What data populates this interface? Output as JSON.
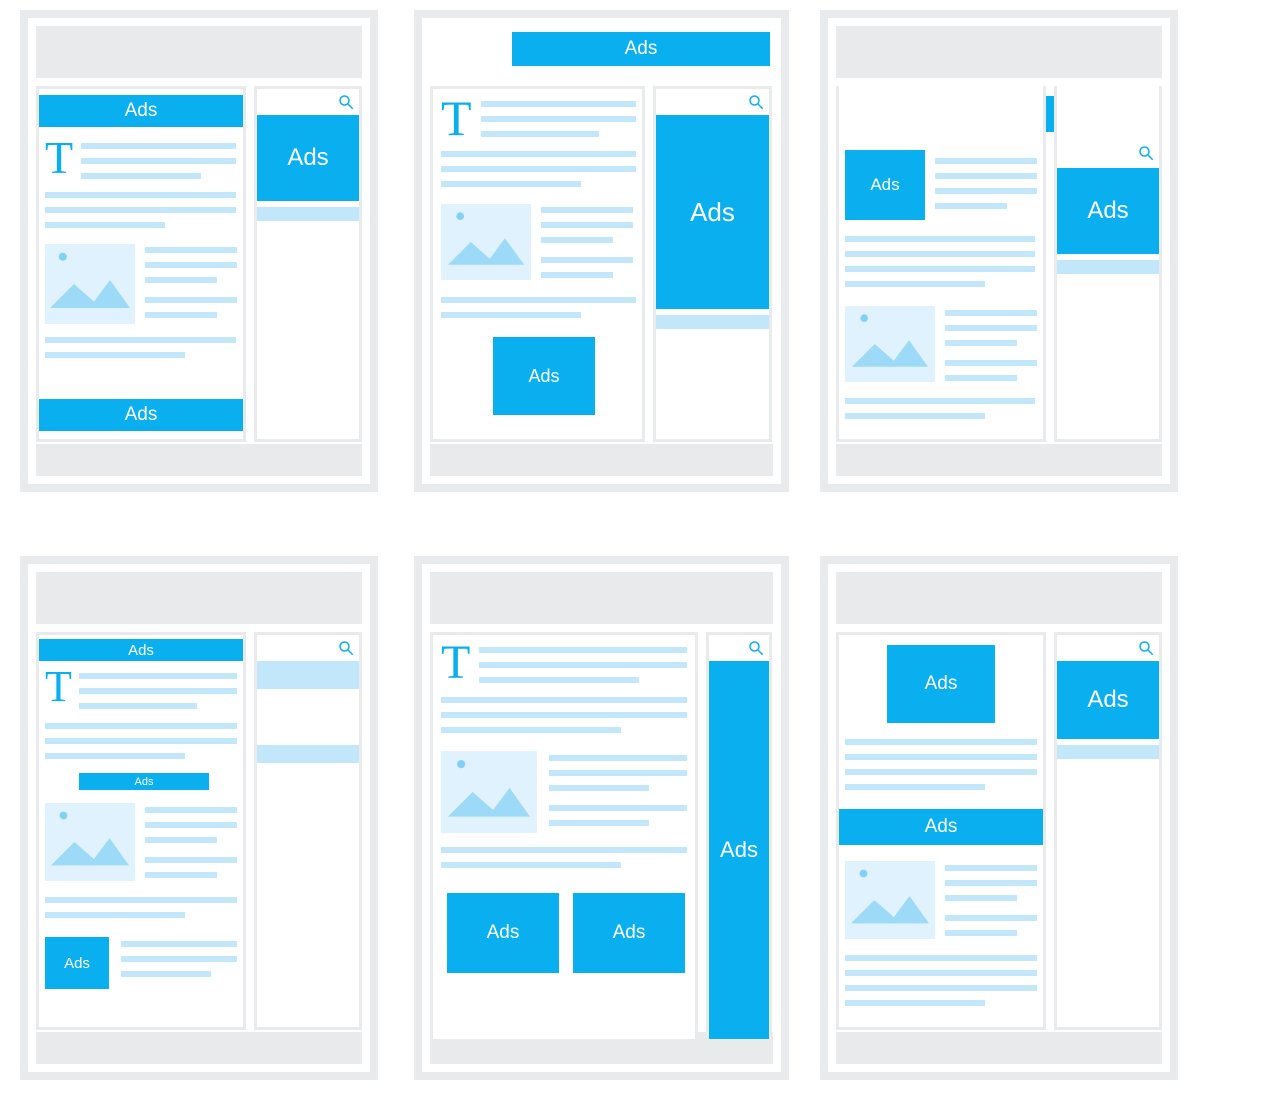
{
  "ads_label": "Ads",
  "dropcap": "T",
  "colors": {
    "accent": "#09afef",
    "pale": "#c2e7fb",
    "paler": "#dff2fd",
    "frame": "#e9eaec"
  },
  "panels": [
    {
      "id": 1,
      "ads": [
        "top-banner",
        "sidebar-rect",
        "bottom-banner"
      ],
      "dropcap": true,
      "search": true
    },
    {
      "id": 2,
      "ads": [
        "hero-banner",
        "tall-sidebar",
        "inline-rect"
      ],
      "dropcap": true,
      "search": true
    },
    {
      "id": 3,
      "ads": [
        "wide-banner",
        "square-pair-left",
        "square-pair-right"
      ],
      "dropcap": false,
      "search": true
    },
    {
      "id": 4,
      "ads": [
        "slim-banner",
        "inline-mini",
        "tiny-square"
      ],
      "dropcap": true,
      "search": true
    },
    {
      "id": 5,
      "ads": [
        "skyscraper",
        "bottom-pair-left",
        "bottom-pair-right"
      ],
      "dropcap": true,
      "search": true
    },
    {
      "id": 6,
      "ads": [
        "center-square",
        "sidebar-square",
        "mid-banner"
      ],
      "dropcap": false,
      "search": true
    }
  ]
}
